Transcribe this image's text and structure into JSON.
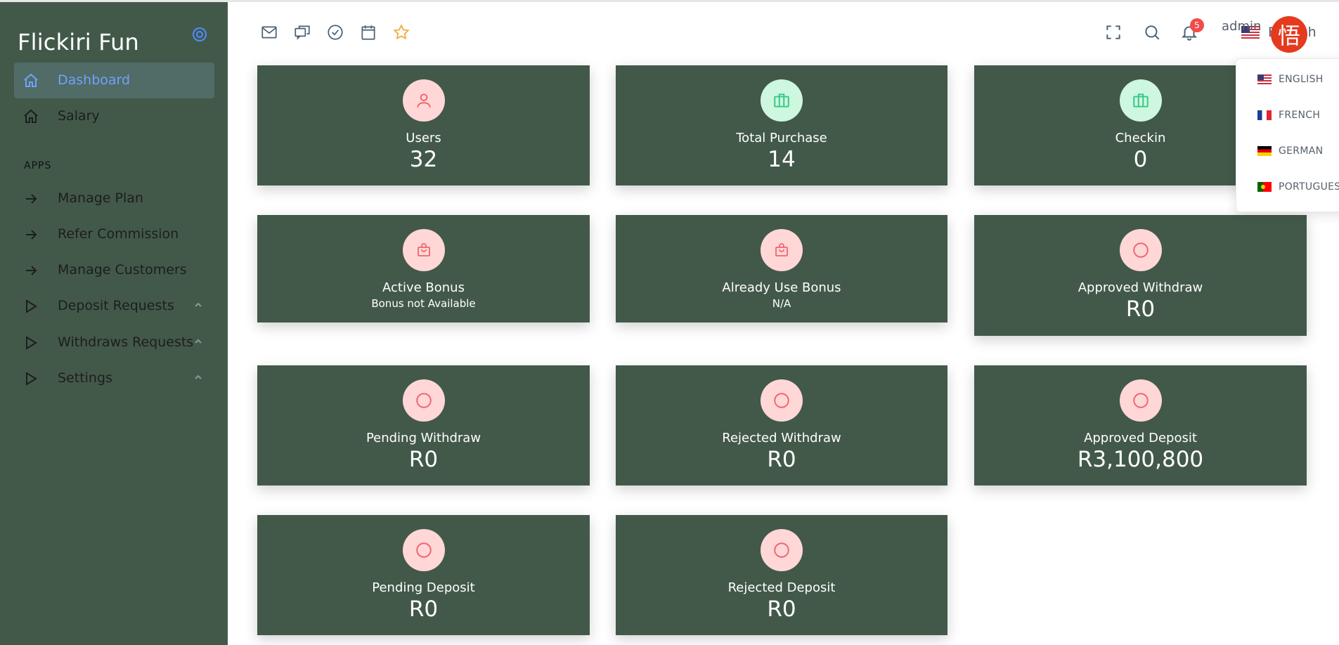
{
  "brand": {
    "title": "Flickiri Fun",
    "accent": "#6ea3ff"
  },
  "sidebar": {
    "items": [
      {
        "label": "Dashboard",
        "icon": "home-icon"
      },
      {
        "label": "Salary",
        "icon": "home-icon"
      }
    ],
    "section_label": "APPS",
    "apps": [
      {
        "label": "Manage Plan",
        "icon": "arrow-right-icon"
      },
      {
        "label": "Refer Commission",
        "icon": "arrow-right-icon"
      },
      {
        "label": "Manage Customers",
        "icon": "arrow-right-icon"
      },
      {
        "label": "Deposit Requests",
        "icon": "play-icon"
      },
      {
        "label": "Withdraws Requests",
        "icon": "play-icon"
      },
      {
        "label": "Settings",
        "icon": "play-icon"
      }
    ]
  },
  "header": {
    "language": "English",
    "notification_count": "5",
    "user_name": "admin",
    "avatar_text": "悟"
  },
  "language_menu": [
    "ENGLISH",
    "FRENCH",
    "GERMAN",
    "PORTUGUESE"
  ],
  "cards": {
    "users": {
      "title": "Users",
      "value": "32"
    },
    "total_purchase": {
      "title": "Total Purchase",
      "value": "14"
    },
    "checkin": {
      "title": "Checkin",
      "value": "0"
    },
    "active_bonus": {
      "title": "Active Bonus",
      "value": "Bonus not Available"
    },
    "already_use_bonus": {
      "title": "Already Use Bonus",
      "value": "N/A"
    },
    "approved_withdraw": {
      "title": "Approved Withdraw",
      "value": "R0"
    },
    "pending_withdraw": {
      "title": "Pending Withdraw",
      "value": "R0"
    },
    "rejected_withdraw": {
      "title": "Rejected Withdraw",
      "value": "R0"
    },
    "approved_deposit": {
      "title": "Approved Deposit",
      "value": "R3,100,800"
    },
    "pending_deposit": {
      "title": "Pending Deposit",
      "value": "R0"
    },
    "rejected_deposit": {
      "title": "Rejected Deposit",
      "value": "R0"
    }
  },
  "colors": {
    "sidebar_bg": "#42594a",
    "card_bg": "#42594a",
    "badge": "#f24b4b",
    "avatar": "#e53a1e"
  }
}
